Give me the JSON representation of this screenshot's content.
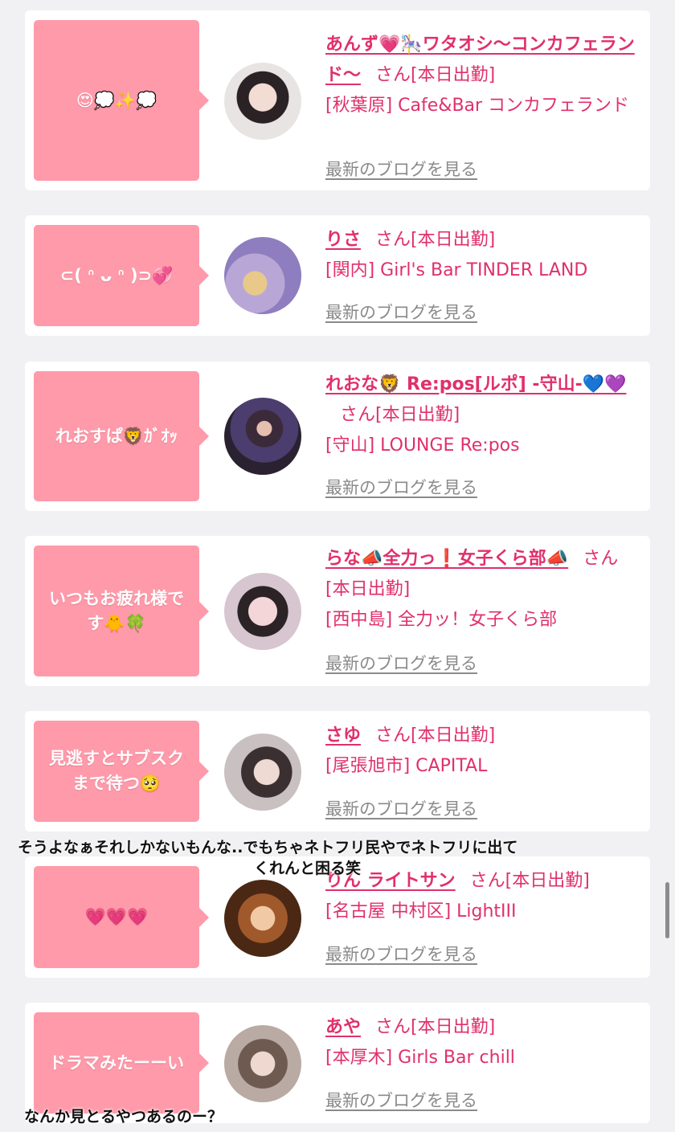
{
  "cards": [
    {
      "bubble": "😍💭✨💭",
      "name": "あんず💗🎠ワタオシ〜コンカフェランド〜",
      "suffix": "さん[本日出勤]",
      "shop": "[秋葉原] Cafe&Bar コンカフェランド",
      "blog": "最新のブログを見る"
    },
    {
      "bubble": "⊂( ᐢ ᴗ ᐢ )⊃💞",
      "name": "りさ",
      "suffix": "さん[本日出勤]",
      "shop": "[関内] Girl's Bar TINDER LAND",
      "blog": "最新のブログを見る"
    },
    {
      "bubble": "れおすぱ🦁ｶﾞｵｯ",
      "name": "れおな🦁 Re:pos[ルポ] -守山-💙💜",
      "suffix": "さん[本日出勤]",
      "shop": "[守山] LOUNGE Re:pos",
      "blog": "最新のブログを見る"
    },
    {
      "bubble": "いつもお疲れ様です🐥🍀",
      "name": "らな📣全力っ❗女子くら部📣",
      "suffix": "さん[本日出勤]",
      "shop": "[西中島] 全力ッ！女子くら部",
      "blog": "最新のブログを見る"
    },
    {
      "bubble": "見逃すとサブスクまで待つ🥺",
      "name": "さゆ",
      "suffix": "さん[本日出勤]",
      "shop": "[尾張旭市] CAPITAL",
      "blog": "最新のブログを見る"
    },
    {
      "bubble": "💗💗💗",
      "name": "りん ライトサン",
      "suffix": "さん[本日出勤]",
      "shop": "[名古屋 中村区] LightIII",
      "blog": "最新のブログを見る"
    },
    {
      "bubble": "ドラマみたーーい",
      "name": "あや",
      "suffix": "さん[本日出勤]",
      "shop": "[本厚木] Girls Bar chill",
      "blog": "最新のブログを見る"
    }
  ],
  "overlay_texts": {
    "caption_1_line_1": "そうよなぁそれしかないもんな..でもちゃネトフリ民やでネトフリに出て",
    "caption_1_line_2": "くれんと困る笑",
    "caption_2": "なんか見とるやつあるのー？"
  },
  "colors": {
    "accent_pink": "#e0306a",
    "bubble_pink": "#ff9aaa",
    "page_bg": "#f1f1f3"
  }
}
